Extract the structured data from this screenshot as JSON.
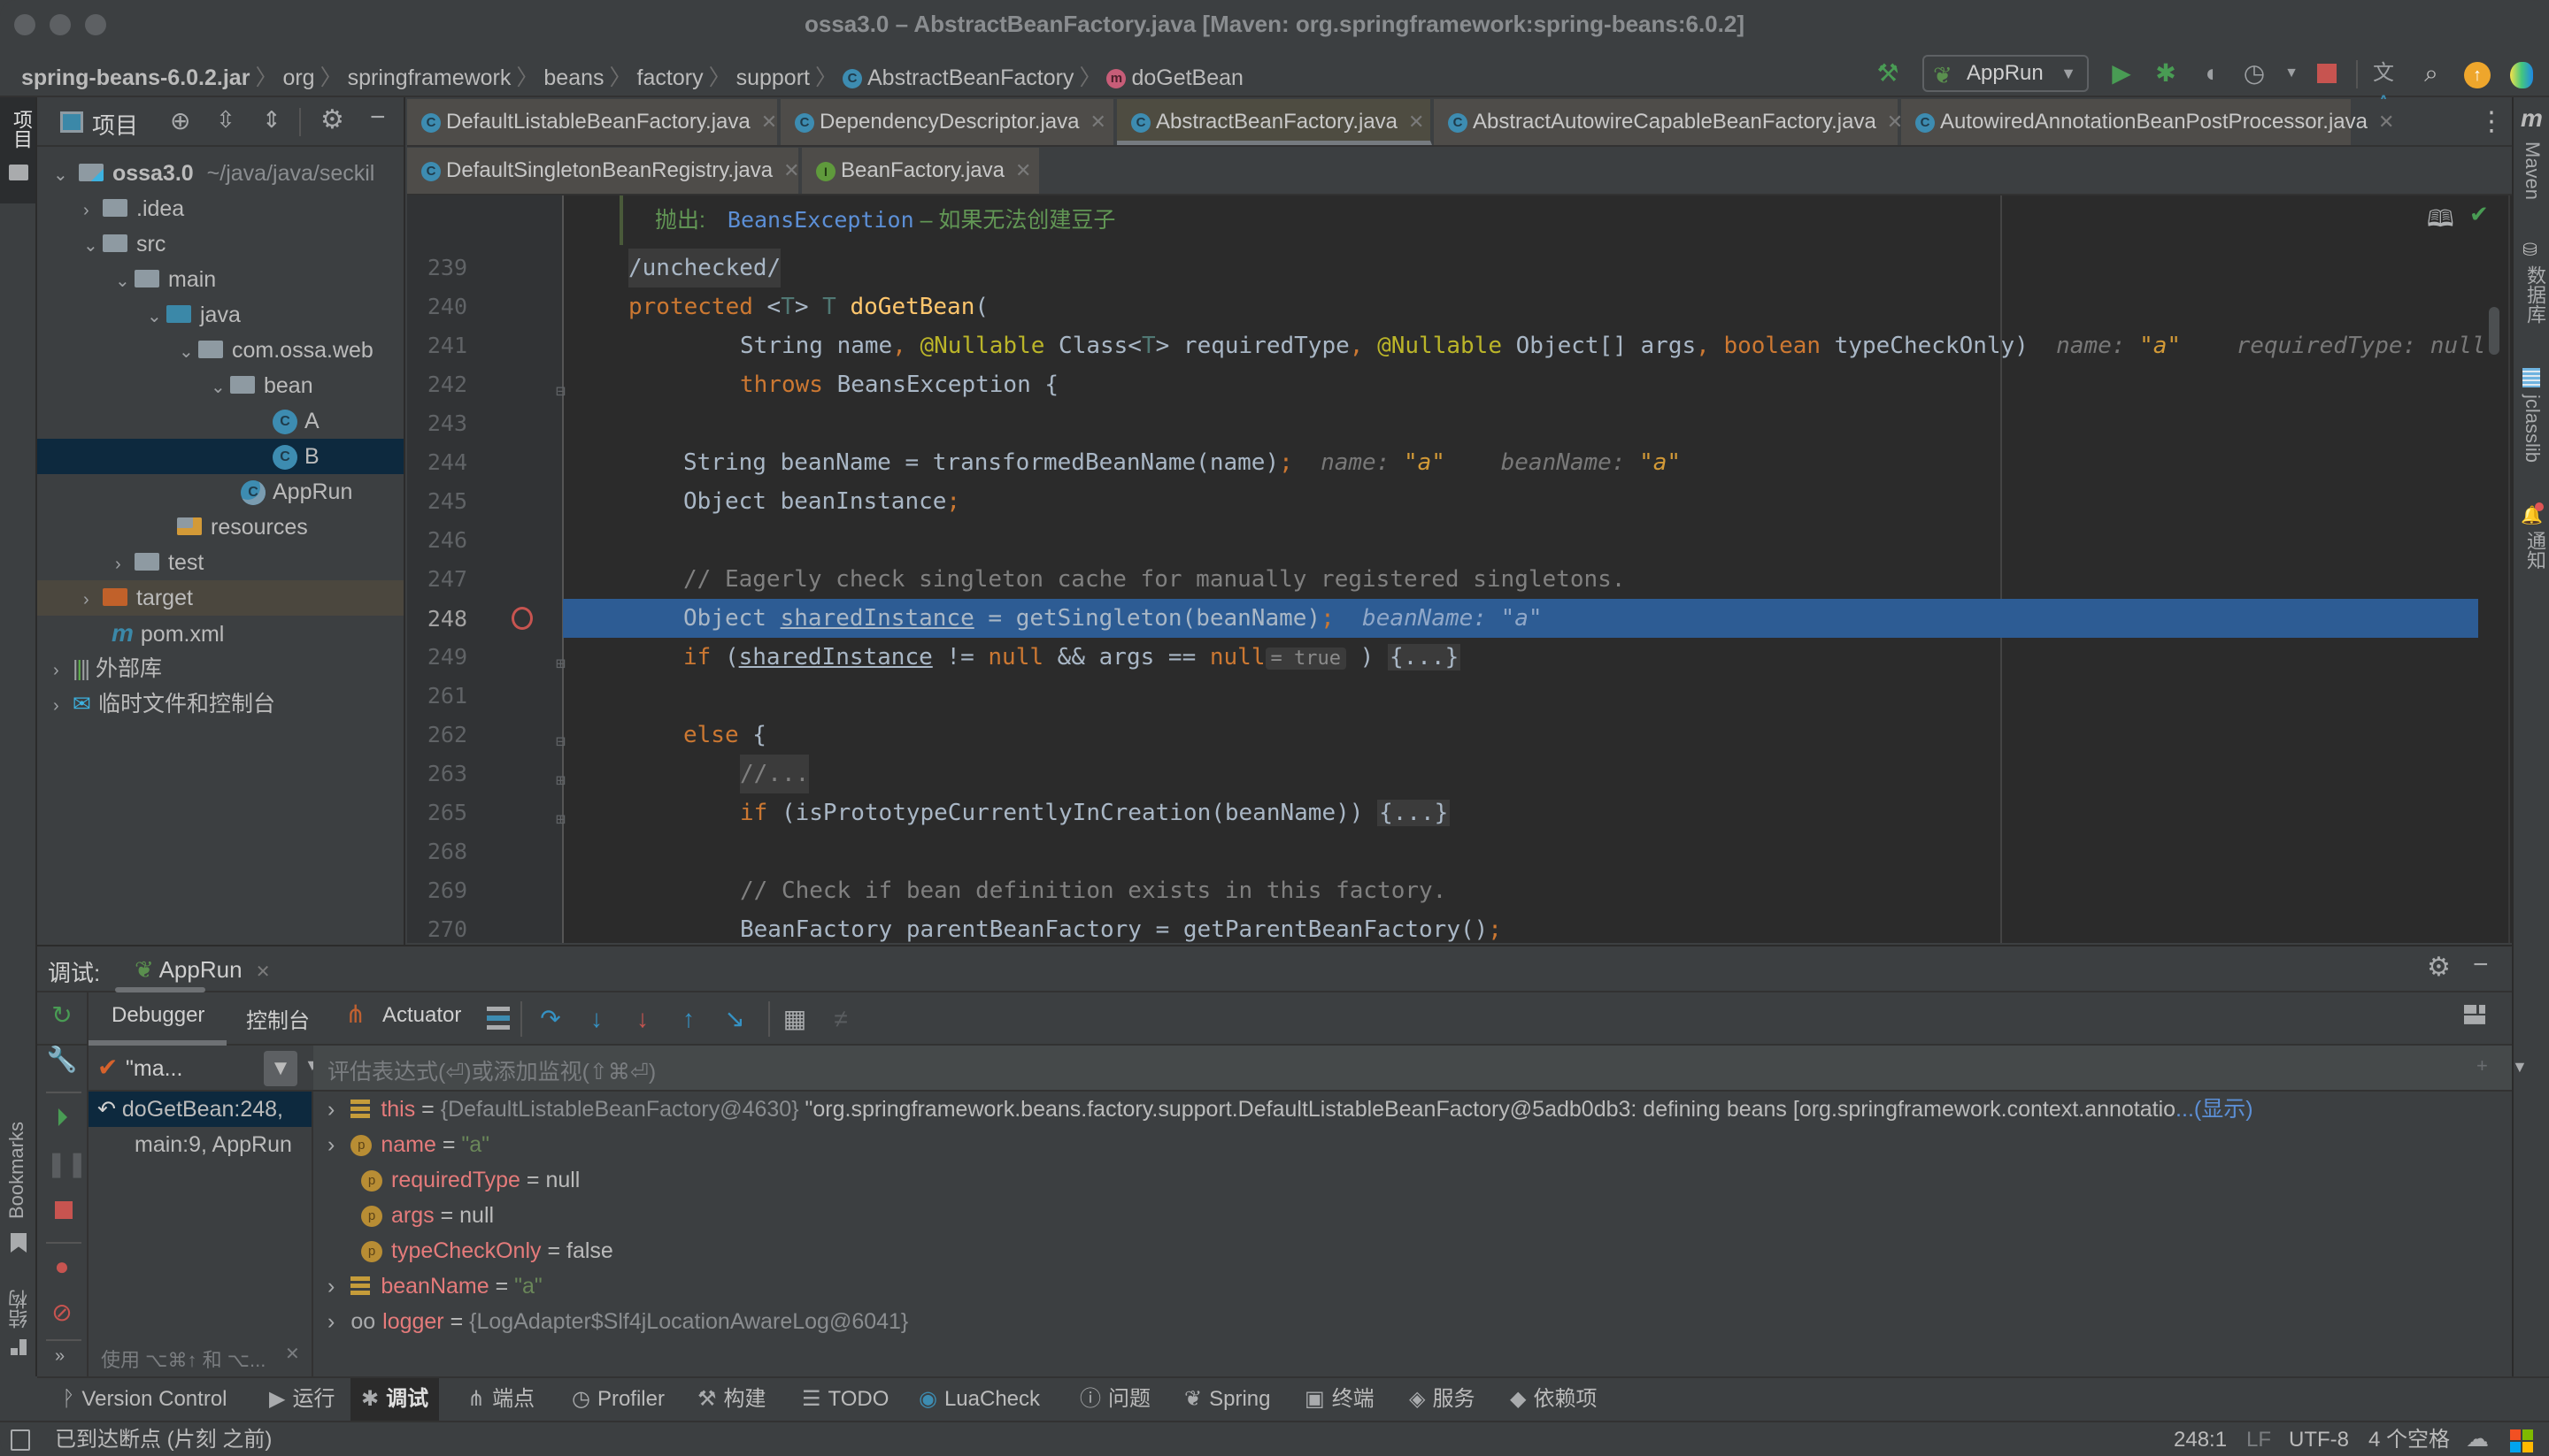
{
  "window": {
    "title": "ossa3.0 – AbstractBeanFactory.java [Maven: org.springframework:spring-beans:6.0.2]"
  },
  "breadcrumb": {
    "items": [
      "spring-beans-6.0.2.jar",
      "org",
      "springframework",
      "beans",
      "factory",
      "support",
      "AbstractBeanFactory",
      "doGetBean"
    ]
  },
  "toolbar": {
    "run_config": "AppRun",
    "icons": [
      "build-hammer-icon",
      "run-icon",
      "debug-icon",
      "coverage-icon",
      "profile-icon",
      "stop-icon",
      "translate-icon",
      "search-icon",
      "update-icon",
      "toolbox-icon"
    ]
  },
  "left_strip": {
    "project_label": "项目",
    "bookmarks_label": "Bookmarks",
    "structure_label": "结构"
  },
  "right_strip": {
    "items": [
      "Maven",
      "数据库",
      "jclasslib",
      "通知"
    ]
  },
  "project": {
    "header_label": "项目",
    "tree": [
      {
        "label": "ossa3.0",
        "suffix": "~/java/java/seckil",
        "depth": 0,
        "expanded": true,
        "kind": "module"
      },
      {
        "label": ".idea",
        "depth": 1,
        "expanded": false,
        "kind": "folder"
      },
      {
        "label": "src",
        "depth": 1,
        "expanded": true,
        "kind": "folder"
      },
      {
        "label": "main",
        "depth": 2,
        "expanded": true,
        "kind": "folder"
      },
      {
        "label": "java",
        "depth": 3,
        "expanded": true,
        "kind": "source-folder"
      },
      {
        "label": "com.ossa.web",
        "depth": 4,
        "expanded": true,
        "kind": "package"
      },
      {
        "label": "bean",
        "depth": 5,
        "expanded": true,
        "kind": "package"
      },
      {
        "label": "A",
        "depth": 6,
        "kind": "class"
      },
      {
        "label": "B",
        "depth": 6,
        "kind": "class",
        "selected": true
      },
      {
        "label": "AppRun",
        "depth": 5,
        "kind": "spring-boot-class"
      },
      {
        "label": "resources",
        "depth": 3,
        "kind": "resources-folder"
      },
      {
        "label": "test",
        "depth": 2,
        "expanded": false,
        "kind": "folder"
      },
      {
        "label": "target",
        "depth": 1,
        "expanded": false,
        "kind": "excluded-folder"
      },
      {
        "label": "pom.xml",
        "depth": 1,
        "kind": "maven-file"
      },
      {
        "label": "外部库",
        "depth": 0,
        "expanded": false,
        "kind": "libraries"
      },
      {
        "label": "临时文件和控制台",
        "depth": 0,
        "expanded": false,
        "kind": "scratches"
      }
    ]
  },
  "tabs": {
    "row1": [
      {
        "label": "DefaultListableBeanFactory.java",
        "icon": "class"
      },
      {
        "label": "DependencyDescriptor.java",
        "icon": "class"
      },
      {
        "label": "AbstractBeanFactory.java",
        "icon": "class",
        "active": true
      },
      {
        "label": "AbstractAutowireCapableBeanFactory.java",
        "icon": "class"
      },
      {
        "label": "AutowiredAnnotationBeanPostProcessor.java",
        "icon": "class"
      }
    ],
    "row2": [
      {
        "label": "DefaultSingletonBeanRegistry.java",
        "icon": "class"
      },
      {
        "label": "BeanFactory.java",
        "icon": "interface"
      }
    ]
  },
  "editor": {
    "doc_throws_label": "抛出:",
    "doc_throws_type": "BeansException",
    "doc_throws_desc": " – 如果无法创建豆子",
    "lines": [
      {
        "num": "239",
        "text": "/unchecked/"
      },
      {
        "num": "240",
        "text": "protected <T> T doGetBean("
      },
      {
        "num": "241",
        "text": "String name, @Nullable Class<T> requiredType, @Nullable Object[] args, boolean typeCheckOnly)"
      },
      {
        "num": "242",
        "text": "throws BeansException {"
      },
      {
        "num": "243",
        "text": ""
      },
      {
        "num": "244",
        "text": "String beanName = transformedBeanName(name);"
      },
      {
        "num": "245",
        "text": "Object beanInstance;"
      },
      {
        "num": "246",
        "text": ""
      },
      {
        "num": "247",
        "text": "// Eagerly check singleton cache for manually registered singletons."
      },
      {
        "num": "248",
        "text": "Object sharedInstance = getSingleton(beanName);",
        "current": true
      },
      {
        "num": "249",
        "text": "if (sharedInstance != null && args == null ) {...}"
      },
      {
        "num": "261",
        "text": ""
      },
      {
        "num": "262",
        "text": "else {"
      },
      {
        "num": "263",
        "text": "//..."
      },
      {
        "num": "265",
        "text": "if (isPrototypeCurrentlyInCreation(beanName)) {...}"
      },
      {
        "num": "268",
        "text": ""
      },
      {
        "num": "269",
        "text": "// Check if bean definition exists in this factory."
      },
      {
        "num": "270",
        "text": "BeanFactory parentBeanFactory = getParentBeanFactory();"
      }
    ],
    "hints": {
      "l241_name": "name: ",
      "l241_name_val": "\"a\"",
      "l241_req": "requiredType: null",
      "l244_name": "name: ",
      "l244_name_val": "\"a\"",
      "l244_bean": "beanName: ",
      "l244_bean_val": "\"a\"",
      "l248_bean": "beanName: \"a\"",
      "l249_inlay": "= true"
    }
  },
  "debug": {
    "title_label": "调试:",
    "session_tab": "AppRun",
    "tabs": [
      "Debugger",
      "控制台",
      "Actuator"
    ],
    "eval_placeholder": "评估表达式(⏎)或添加监视(⇧⌘⏎)",
    "thread_label": "\"ma...",
    "frames": [
      {
        "label": "doGetBean:248,",
        "selected": true
      },
      {
        "label": "main:9, AppRun"
      }
    ],
    "frames_hint": "使用 ⌥⌘↑ 和 ⌥...",
    "variables": [
      {
        "name": "this",
        "eq": " = ",
        "value": "{DefaultListableBeanFactory@4630}",
        "extra": " \"org.springframework.beans.factory.support.DefaultListableBeanFactory@5adb0db3: defining beans [org.springframework.context.annotatio",
        "more": "...(显示)",
        "kind": "field",
        "expandable": true
      },
      {
        "name": "name",
        "eq": " = ",
        "value": "\"a\"",
        "kind": "param",
        "expandable": true,
        "string": true
      },
      {
        "name": "requiredType",
        "eq": " = ",
        "value": "null",
        "kind": "param"
      },
      {
        "name": "args",
        "eq": " = ",
        "value": "null",
        "kind": "param"
      },
      {
        "name": "typeCheckOnly",
        "eq": " = ",
        "value": "false",
        "kind": "param"
      },
      {
        "name": "beanName",
        "eq": " = ",
        "value": "\"a\"",
        "kind": "field",
        "expandable": true,
        "string": true
      },
      {
        "name": "logger",
        "eq": " = ",
        "value": "{LogAdapter$Slf4jLocationAwareLog@6041}",
        "kind": "watch",
        "expandable": true
      }
    ]
  },
  "bottom_bar": {
    "items": [
      {
        "label": "Version Control",
        "icon": "vcs-icon"
      },
      {
        "label": "运行",
        "icon": "run-icon"
      },
      {
        "label": "调试",
        "icon": "debug-icon",
        "active": true
      },
      {
        "label": "端点",
        "icon": "endpoints-icon"
      },
      {
        "label": "Profiler",
        "icon": "profiler-icon"
      },
      {
        "label": "构建",
        "icon": "build-icon"
      },
      {
        "label": "TODO",
        "icon": "todo-icon"
      },
      {
        "label": "LuaCheck",
        "icon": "luacheck-icon"
      },
      {
        "label": "问题",
        "icon": "problems-icon"
      },
      {
        "label": "Spring",
        "icon": "spring-icon"
      },
      {
        "label": "终端",
        "icon": "terminal-icon"
      },
      {
        "label": "服务",
        "icon": "services-icon"
      },
      {
        "label": "依赖项",
        "icon": "dependencies-icon"
      }
    ]
  },
  "status_bar": {
    "message": "已到达断点 (片刻 之前)",
    "position": "248:1",
    "line_sep": "LF",
    "encoding": "UTF-8",
    "indent": "4 个空格"
  },
  "colors": {
    "accent_blue": "#2d5c94",
    "selection_dark": "#0d293e",
    "breakpoint_red": "#c75450",
    "keyword_orange": "#cc7832",
    "run_green": "#499c54"
  }
}
